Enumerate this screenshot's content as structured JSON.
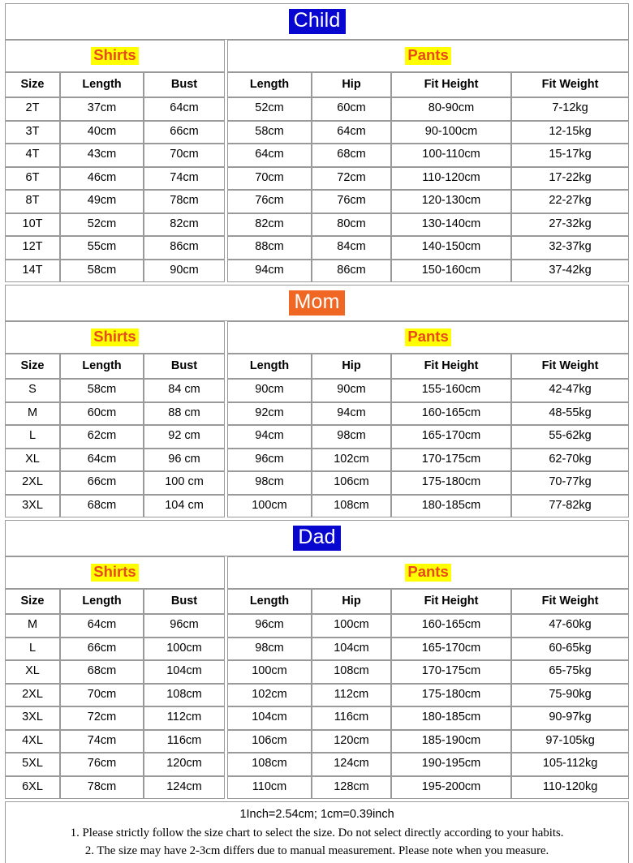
{
  "columns": {
    "size": "Size",
    "length_shirt": "Length",
    "bust": "Bust",
    "length_pants": "Length",
    "hip": "Hip",
    "fit_height": "Fit Height",
    "fit_weight": "Fit Weight"
  },
  "groups": {
    "shirts": "Shirts",
    "pants": "Pants"
  },
  "colors": {
    "child_title_bg": "#0707cf",
    "mom_title_bg": "#ef6722",
    "dad_title_bg": "#0707cf",
    "title_text": "#ffffff",
    "group_bg": "#ffff00",
    "group_text": "#e8491d",
    "border": "#9a9a9a",
    "cell_bg": "#ffffff",
    "text": "#000000"
  },
  "sections": [
    {
      "title": "Child",
      "title_style": "blue",
      "rows": [
        {
          "size": "2T",
          "length_shirt": "37cm",
          "bust": "64cm",
          "length_pants": "52cm",
          "hip": "60cm",
          "fit_height": "80-90cm",
          "fit_weight": "7-12kg"
        },
        {
          "size": "3T",
          "length_shirt": "40cm",
          "bust": "66cm",
          "length_pants": "58cm",
          "hip": "64cm",
          "fit_height": "90-100cm",
          "fit_weight": "12-15kg"
        },
        {
          "size": "4T",
          "length_shirt": "43cm",
          "bust": "70cm",
          "length_pants": "64cm",
          "hip": "68cm",
          "fit_height": "100-110cm",
          "fit_weight": "15-17kg"
        },
        {
          "size": "6T",
          "length_shirt": "46cm",
          "bust": "74cm",
          "length_pants": "70cm",
          "hip": "72cm",
          "fit_height": "110-120cm",
          "fit_weight": "17-22kg"
        },
        {
          "size": "8T",
          "length_shirt": "49cm",
          "bust": "78cm",
          "length_pants": "76cm",
          "hip": "76cm",
          "fit_height": "120-130cm",
          "fit_weight": "22-27kg"
        },
        {
          "size": "10T",
          "length_shirt": "52cm",
          "bust": "82cm",
          "length_pants": "82cm",
          "hip": "80cm",
          "fit_height": "130-140cm",
          "fit_weight": "27-32kg"
        },
        {
          "size": "12T",
          "length_shirt": "55cm",
          "bust": "86cm",
          "length_pants": "88cm",
          "hip": "84cm",
          "fit_height": "140-150cm",
          "fit_weight": "32-37kg"
        },
        {
          "size": "14T",
          "length_shirt": "58cm",
          "bust": "90cm",
          "length_pants": "94cm",
          "hip": "86cm",
          "fit_height": "150-160cm",
          "fit_weight": "37-42kg"
        }
      ]
    },
    {
      "title": "Mom",
      "title_style": "orange",
      "rows": [
        {
          "size": "S",
          "length_shirt": "58cm",
          "bust": "84 cm",
          "length_pants": "90cm",
          "hip": "90cm",
          "fit_height": "155-160cm",
          "fit_weight": "42-47kg"
        },
        {
          "size": "M",
          "length_shirt": "60cm",
          "bust": "88 cm",
          "length_pants": "92cm",
          "hip": "94cm",
          "fit_height": "160-165cm",
          "fit_weight": "48-55kg"
        },
        {
          "size": "L",
          "length_shirt": "62cm",
          "bust": "92 cm",
          "length_pants": "94cm",
          "hip": "98cm",
          "fit_height": "165-170cm",
          "fit_weight": "55-62kg"
        },
        {
          "size": "XL",
          "length_shirt": "64cm",
          "bust": "96 cm",
          "length_pants": "96cm",
          "hip": "102cm",
          "fit_height": "170-175cm",
          "fit_weight": "62-70kg"
        },
        {
          "size": "2XL",
          "length_shirt": "66cm",
          "bust": "100 cm",
          "length_pants": "98cm",
          "hip": "106cm",
          "fit_height": "175-180cm",
          "fit_weight": "70-77kg"
        },
        {
          "size": "3XL",
          "length_shirt": "68cm",
          "bust": "104 cm",
          "length_pants": "100cm",
          "hip": "108cm",
          "fit_height": "180-185cm",
          "fit_weight": "77-82kg"
        }
      ]
    },
    {
      "title": "Dad",
      "title_style": "blue",
      "rows": [
        {
          "size": "M",
          "length_shirt": "64cm",
          "bust": "96cm",
          "length_pants": "96cm",
          "hip": "100cm",
          "fit_height": "160-165cm",
          "fit_weight": "47-60kg"
        },
        {
          "size": "L",
          "length_shirt": "66cm",
          "bust": "100cm",
          "length_pants": "98cm",
          "hip": "104cm",
          "fit_height": "165-170cm",
          "fit_weight": "60-65kg"
        },
        {
          "size": "XL",
          "length_shirt": "68cm",
          "bust": "104cm",
          "length_pants": "100cm",
          "hip": "108cm",
          "fit_height": "170-175cm",
          "fit_weight": "65-75kg"
        },
        {
          "size": "2XL",
          "length_shirt": "70cm",
          "bust": "108cm",
          "length_pants": "102cm",
          "hip": "112cm",
          "fit_height": "175-180cm",
          "fit_weight": "75-90kg"
        },
        {
          "size": "3XL",
          "length_shirt": "72cm",
          "bust": "112cm",
          "length_pants": "104cm",
          "hip": "116cm",
          "fit_height": "180-185cm",
          "fit_weight": "90-97kg"
        },
        {
          "size": "4XL",
          "length_shirt": "74cm",
          "bust": "116cm",
          "length_pants": "106cm",
          "hip": "120cm",
          "fit_height": "185-190cm",
          "fit_weight": "97-105kg"
        },
        {
          "size": "5XL",
          "length_shirt": "76cm",
          "bust": "120cm",
          "length_pants": "108cm",
          "hip": "124cm",
          "fit_height": "190-195cm",
          "fit_weight": "105-112kg"
        },
        {
          "size": "6XL",
          "length_shirt": "78cm",
          "bust": "124cm",
          "length_pants": "110cm",
          "hip": "128cm",
          "fit_height": "195-200cm",
          "fit_weight": "110-120kg"
        }
      ]
    }
  ],
  "footer": {
    "conversion": "1Inch=2.54cm; 1cm=0.39inch",
    "note1": "1. Please strictly follow the size chart to select the size. Do not select directly according to your habits.",
    "note2": "2. The size may have 2-3cm differs due to manual measurement. Please note when you measure."
  }
}
